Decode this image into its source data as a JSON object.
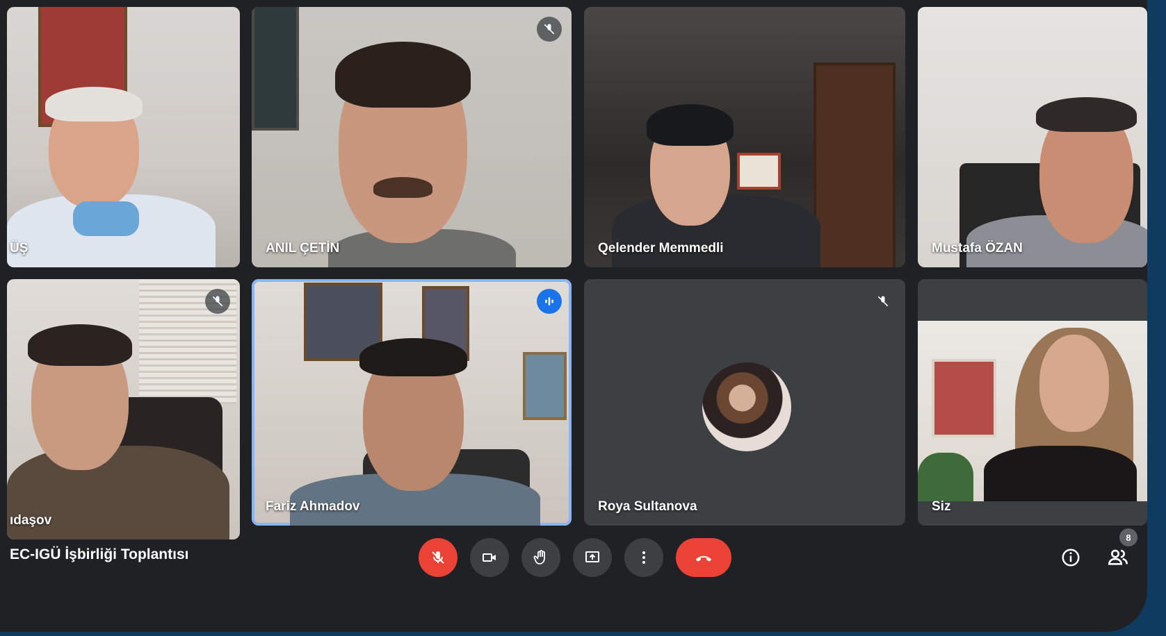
{
  "meeting": {
    "title": "EC-IGÜ İşbirliği Toplantısı"
  },
  "participants": [
    {
      "name": "ÜŞ",
      "muted": false
    },
    {
      "name": "ANIL ÇETİN",
      "muted": true
    },
    {
      "name": "Qelender Memmedli",
      "muted": false
    },
    {
      "name": "Mustafa ÖZAN",
      "muted": false
    },
    {
      "name": "ıdaşov",
      "muted": true
    },
    {
      "name": "Fariz Ahmadov",
      "speaking": true
    },
    {
      "name": "Roya Sultanova",
      "muted": true,
      "avatar_only": true
    },
    {
      "name": "Siz",
      "muted": false
    }
  ],
  "controls": {
    "mic": "mic-off-icon",
    "camera": "camera-icon",
    "raise_hand": "raise-hand-icon",
    "present": "present-screen-icon",
    "more": "more-vert-icon",
    "leave": "call-end-icon"
  },
  "right_icons": {
    "info": "info-icon",
    "people": "people-icon",
    "participant_count": "8"
  },
  "colors": {
    "speaking_border": "#8ab4f8",
    "hangup": "#ea4335",
    "page_bg": "#0f3b5e",
    "window_bg": "#202124"
  }
}
